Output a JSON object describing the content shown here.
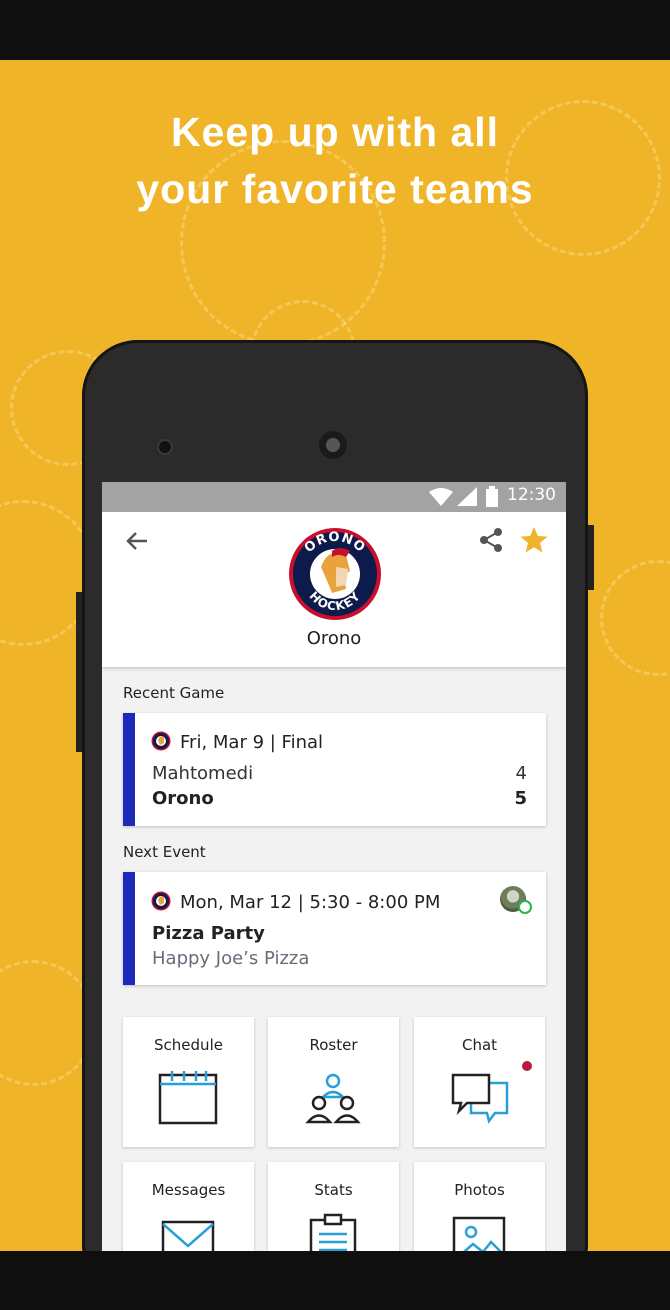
{
  "headline": {
    "line1": "Keep up with all",
    "line2": "your favorite teams"
  },
  "colors": {
    "background": "#f0b429",
    "accent_bar": "#1b2ab8",
    "star": "#f0b429",
    "notification": "#b71c3c",
    "icon_blue": "#2a9fd6"
  },
  "status_bar": {
    "time": "12:30",
    "icons": [
      "wifi-icon",
      "signal-icon",
      "battery-icon"
    ]
  },
  "header": {
    "team_name": "Orono",
    "logo_text_top": "ORONO",
    "logo_text_bottom": "HOCKEY",
    "actions": [
      "back-icon",
      "share-icon",
      "star-icon"
    ]
  },
  "recent_game": {
    "section_label": "Recent Game",
    "date_status": "Fri, Mar 9 | Final",
    "teams": [
      {
        "name": "Mahtomedi",
        "score": "4",
        "winner": false
      },
      {
        "name": "Orono",
        "score": "5",
        "winner": true
      }
    ]
  },
  "next_event": {
    "section_label": "Next Event",
    "datetime": "Mon, Mar 12 | 5:30 - 8:00 PM",
    "title": "Pizza Party",
    "location": "Happy Joe’s Pizza"
  },
  "tiles": [
    {
      "label": "Schedule",
      "icon": "calendar-icon"
    },
    {
      "label": "Roster",
      "icon": "people-icon"
    },
    {
      "label": "Chat",
      "icon": "chat-icon",
      "has_notification": true
    },
    {
      "label": "Messages",
      "icon": "envelope-icon"
    },
    {
      "label": "Stats",
      "icon": "clipboard-icon"
    },
    {
      "label": "Photos",
      "icon": "photo-icon"
    }
  ]
}
